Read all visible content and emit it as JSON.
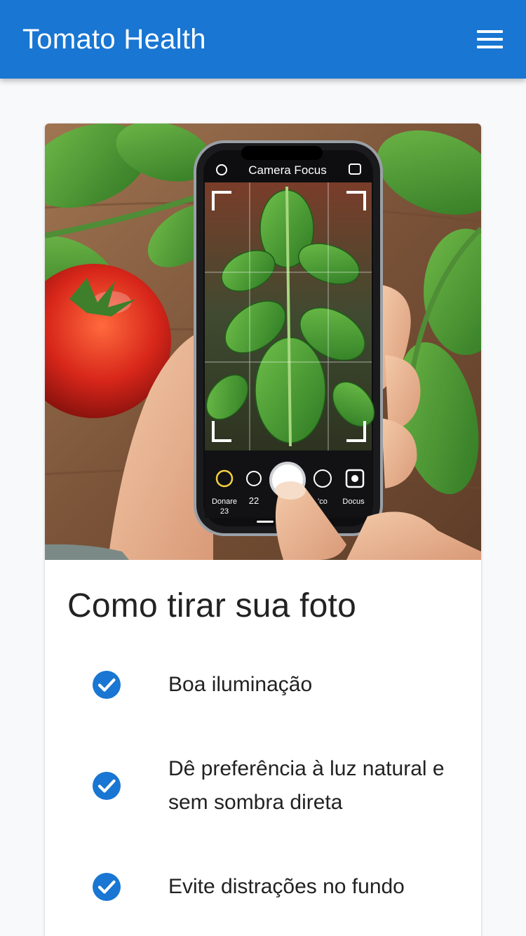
{
  "app": {
    "title": "Tomato Health",
    "menu_icon": "hamburger-menu-icon"
  },
  "colors": {
    "primary": "#1976d2",
    "check": "#1976d2",
    "background": "#f8f9fb"
  },
  "hero": {
    "phone_screen_title": "Camera Focus",
    "camera_labels": [
      "Donare",
      "22",
      "Docus"
    ],
    "camera_sublabel": "23",
    "camera_partial_label": "'co"
  },
  "guide": {
    "title": "Como tirar sua foto",
    "tips": [
      {
        "text": "Boa iluminação",
        "icon": "check-circle-icon"
      },
      {
        "text": "Dê preferência à luz natural e sem sombra direta",
        "icon": "check-circle-icon"
      },
      {
        "text": "Evite distrações no fundo",
        "icon": "check-circle-icon"
      }
    ]
  }
}
